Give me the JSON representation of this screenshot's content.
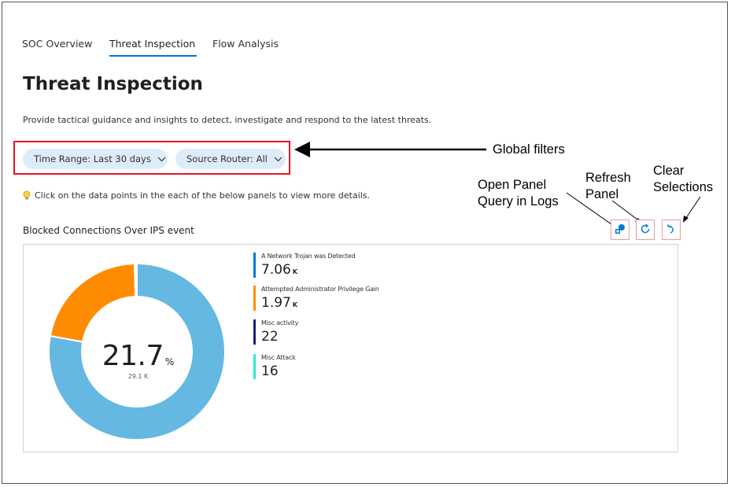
{
  "tabs": [
    {
      "label": "SOC Overview",
      "active": false
    },
    {
      "label": "Threat Inspection",
      "active": true
    },
    {
      "label": "Flow Analysis",
      "active": false
    }
  ],
  "page": {
    "title": "Threat Inspection",
    "subtitle": "Provide tactical guidance and insights to detect, investigate and respond to the latest threats.",
    "hint": "Click on the data points in the each of the below panels to view more details."
  },
  "filters": {
    "time_range": "Time Range: Last 30 days",
    "source_router": "Source Router: All"
  },
  "annotations": {
    "global_filters": "Global filters",
    "open_panel_line1": "Open Panel",
    "open_panel_line2": "Query in Logs",
    "refresh_line1": "Refresh",
    "refresh_line2": "Panel",
    "clear_line1": "Clear",
    "clear_line2": "Selections"
  },
  "panel": {
    "title": "Blocked Connections Over IPS event",
    "center_value": "21.7",
    "center_unit": "%",
    "center_sub": "29.1 K",
    "icons": [
      "query-logs-icon",
      "refresh-icon",
      "undo-icon"
    ]
  },
  "colors": {
    "accent": "#0078d4",
    "highlight_border": "#e81123",
    "pill_bg": "#deecf9"
  },
  "chart_data": {
    "type": "pie",
    "donut": true,
    "categories": [
      "A Network Trojan was Detected",
      "Attempted Administrator Privilege Gain",
      "Misc activity",
      "Misc Attack"
    ],
    "values": [
      7060,
      1970,
      22,
      16
    ],
    "display_values": [
      "7.06",
      "1.97",
      "22",
      "16"
    ],
    "display_units": [
      "K",
      "K",
      "",
      ""
    ],
    "colors": [
      "#64b8e1",
      "#ff8c00",
      "#1a237e",
      "#2ee8d0"
    ],
    "legend_bar_colors": [
      "#0078d4",
      "#ff8c00",
      "#1a237e",
      "#2ee8d0"
    ],
    "legend": "right"
  }
}
